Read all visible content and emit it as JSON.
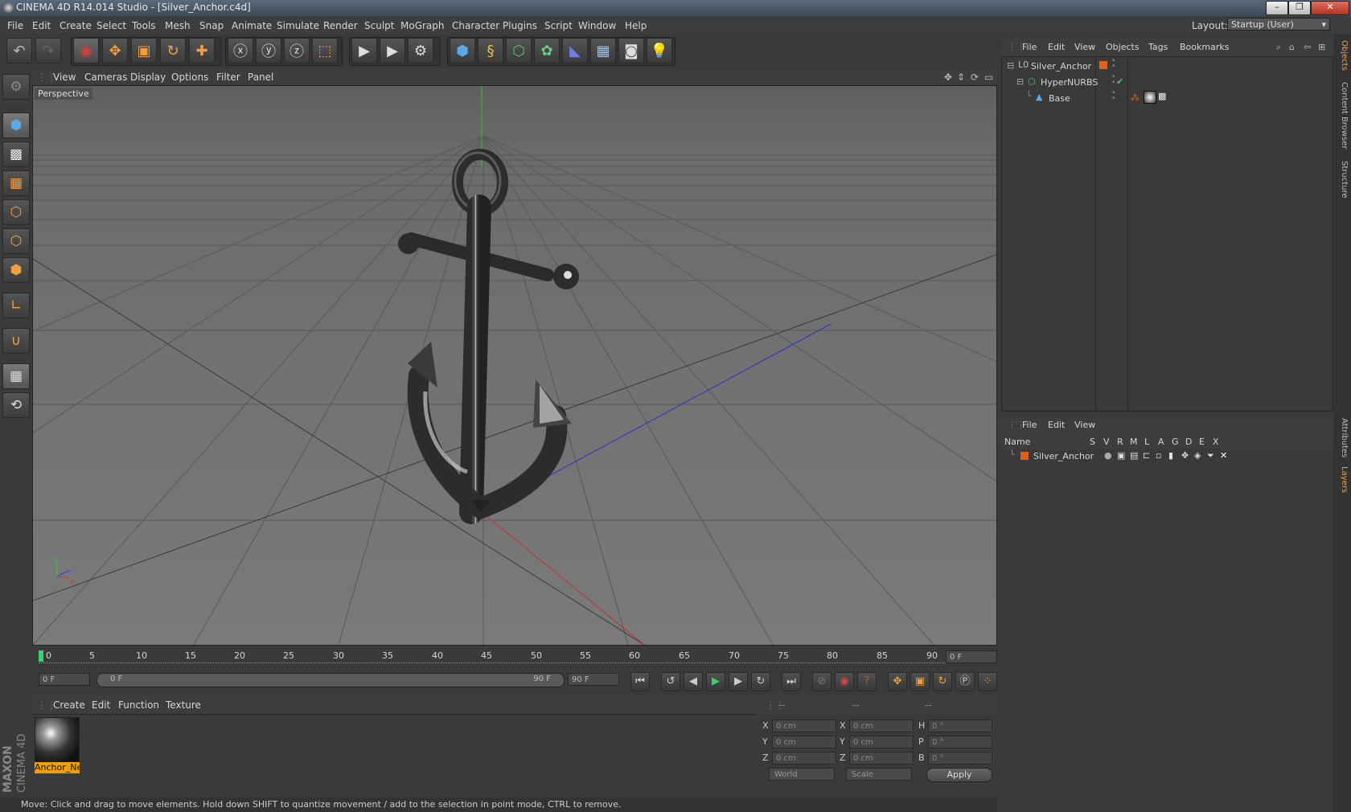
{
  "window": {
    "title": "CINEMA 4D R14.014 Studio - [Silver_Anchor.c4d]",
    "min": "–",
    "max": "❐",
    "close": "✕"
  },
  "menu": [
    "File",
    "Edit",
    "Create",
    "Select",
    "Tools",
    "Mesh",
    "Snap",
    "Animate",
    "Simulate",
    "Render",
    "Sculpt",
    "MoGraph",
    "Character",
    "Plugins",
    "Script",
    "Window",
    "Help"
  ],
  "layout": {
    "label": "Layout:",
    "value": "Startup (User)"
  },
  "viewport": {
    "menu": [
      "View",
      "Cameras",
      "Display",
      "Options",
      "Filter",
      "Panel"
    ],
    "label": "Perspective",
    "axis_y": "y",
    "axis_x": "x",
    "axis_z": "z"
  },
  "timeline": {
    "ticks": [
      "0",
      "5",
      "10",
      "15",
      "20",
      "25",
      "30",
      "35",
      "40",
      "45",
      "50",
      "55",
      "60",
      "65",
      "70",
      "75",
      "80",
      "85",
      "90"
    ],
    "current_frame": "0 F",
    "start_field": "0 F",
    "range_start": "0 F",
    "range_end": "90 F",
    "end_field": "90 F"
  },
  "materials": {
    "menu": [
      "Create",
      "Edit",
      "Function",
      "Texture"
    ],
    "item": "Anchor_Ne"
  },
  "coords": {
    "head": [
      "--",
      "--",
      "--"
    ],
    "rows": [
      {
        "a": "X",
        "av": "0 cm",
        "b": "X",
        "bv": "0 cm",
        "c": "H",
        "cv": "0 °"
      },
      {
        "a": "Y",
        "av": "0 cm",
        "b": "Y",
        "bv": "0 cm",
        "c": "P",
        "cv": "0 °"
      },
      {
        "a": "Z",
        "av": "0 cm",
        "b": "Z",
        "bv": "0 cm",
        "c": "B",
        "cv": "0 °"
      }
    ],
    "mode1": "World",
    "mode2": "Scale",
    "apply": "Apply"
  },
  "objects": {
    "menu": [
      "File",
      "Edit",
      "View",
      "Objects",
      "Tags",
      "Bookmarks"
    ],
    "items": [
      "Silver_Anchor",
      "HyperNURBS",
      "Base"
    ]
  },
  "layers": {
    "menu": [
      "File",
      "Edit",
      "View"
    ],
    "columns": [
      "Name",
      "S",
      "V",
      "R",
      "M",
      "L",
      "A",
      "G",
      "D",
      "E",
      "X"
    ],
    "items": [
      "Silver_Anchor"
    ]
  },
  "right_tabs": [
    "Objects",
    "Content Browser",
    "Structure",
    "Attributes",
    "Layers"
  ],
  "status": "Move: Click and drag to move elements. Hold down SHIFT to quantize movement / add to the selection in point mode, CTRL to remove.",
  "brand": [
    "MAXON",
    "CINEMA 4D"
  ],
  "colors": {
    "accent": "#f0a000",
    "layer_orange": "#e06020",
    "timeline_green": "#3bd16f"
  }
}
